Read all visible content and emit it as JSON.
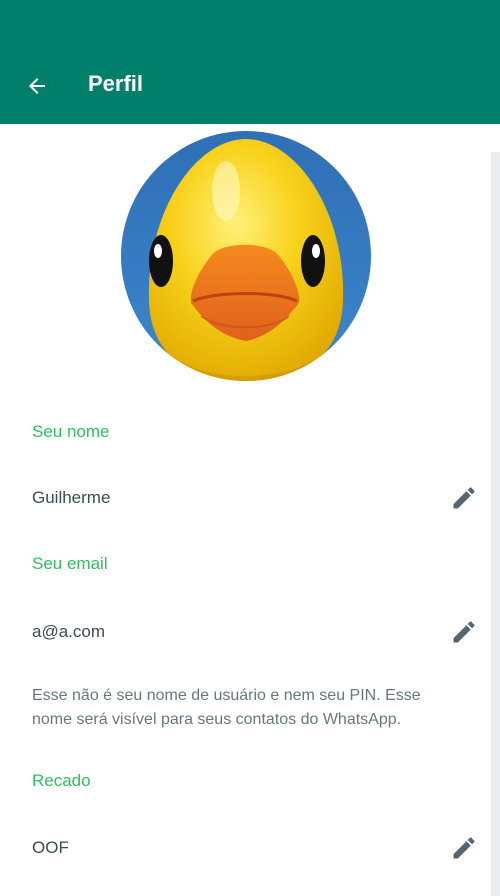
{
  "header": {
    "title": "Perfil",
    "back_icon": "arrow-left-icon",
    "background_color": "#00806a"
  },
  "profile": {
    "photo_icon": "rubber-duck-photo"
  },
  "fields": {
    "name": {
      "label": "Seu nome",
      "value": "Guilherme",
      "edit_icon": "pencil-icon"
    },
    "email": {
      "label": "Seu email",
      "value": "a@a.com",
      "edit_icon": "pencil-icon"
    },
    "info_text": "Esse não é seu nome de usuário e nem seu PIN. Esse nome será visível para seus contatos do WhatsApp.",
    "status": {
      "label": "Recado",
      "value": "OOF",
      "edit_icon": "pencil-icon"
    }
  },
  "colors": {
    "accent_label": "#2fbf5a",
    "text": "#3b4a54",
    "muted_text": "#667781",
    "icon": "#54656f"
  }
}
